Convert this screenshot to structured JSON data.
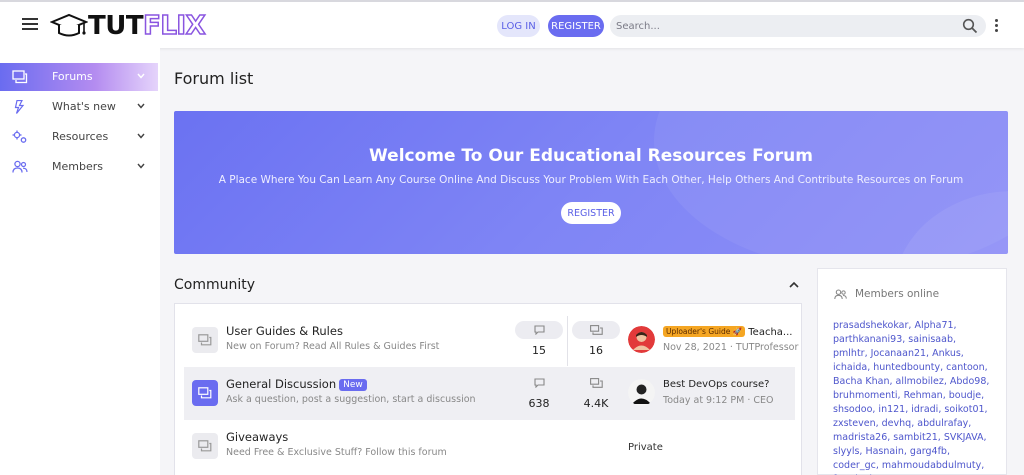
{
  "header": {
    "logo": {
      "part1": "TUT",
      "part2": "FLIX"
    },
    "login_label": "LOG IN",
    "register_label": "REGISTER",
    "search_placeholder": "Search..."
  },
  "sidebar": {
    "items": [
      {
        "label": "Forums",
        "icon": "forum-icon",
        "active": true
      },
      {
        "label": "What's new",
        "icon": "lightning-icon",
        "active": false
      },
      {
        "label": "Resources",
        "icon": "cogs-icon",
        "active": false
      },
      {
        "label": "Members",
        "icon": "users-icon",
        "active": false
      }
    ]
  },
  "page": {
    "title": "Forum list"
  },
  "banner": {
    "title": "Welcome To Our Educational Resources Forum",
    "subtitle": "A Place Where You Can Learn Any Course Online And Discuss Your Problem With Each Other, Help Others And Contribute Resources on Forum",
    "button_label": "REGISTER"
  },
  "community": {
    "title": "Community",
    "forums": [
      {
        "name": "User Guides & Rules",
        "description": "New on Forum? Read All Rules & Guides First",
        "threads": "15",
        "messages": "16",
        "latest": {
          "badge": "Uploader's Guide 🚀",
          "title": "Teacha...",
          "meta": "Nov 28, 2021 · TUTProfessor"
        }
      },
      {
        "name": "General Discussion",
        "new_badge": "New",
        "description": "Ask a question, post a suggestion, start a discussion",
        "threads": "638",
        "messages": "4.4K",
        "latest": {
          "title": "Best DevOps course?",
          "meta": "Today at 9:12 PM · CEO"
        }
      },
      {
        "name": "Giveaways",
        "description": "Need Free & Exclusive Stuff? Follow this forum",
        "private_label": "Private"
      }
    ]
  },
  "members_online": {
    "title": "Members online",
    "list": "prasadshekokar, Alpha71, parthkanani93, sainisaab, pmlhtr, Jocanaan21, Ankus, ichaida, huntedbounty, cantoon, Bacha Khan, allmobilez, Abdo98, bruhmomenti, Rehman, boudje, shsodoo, in121, idradi, soikot01, zxsteven, devhq, abdulrafay, madrista26, sambit21, SVKJAVA, slyyls, Hasnain, garg4fb, coder_gc, mahmoudabdulmuty, freed, viea,"
  },
  "colors": {
    "accent": "#6a6cf0",
    "banner_start": "#6b72f2",
    "banner_end": "#8e8ff7",
    "link": "#4e56cc",
    "role_badge": "#f5a623"
  }
}
